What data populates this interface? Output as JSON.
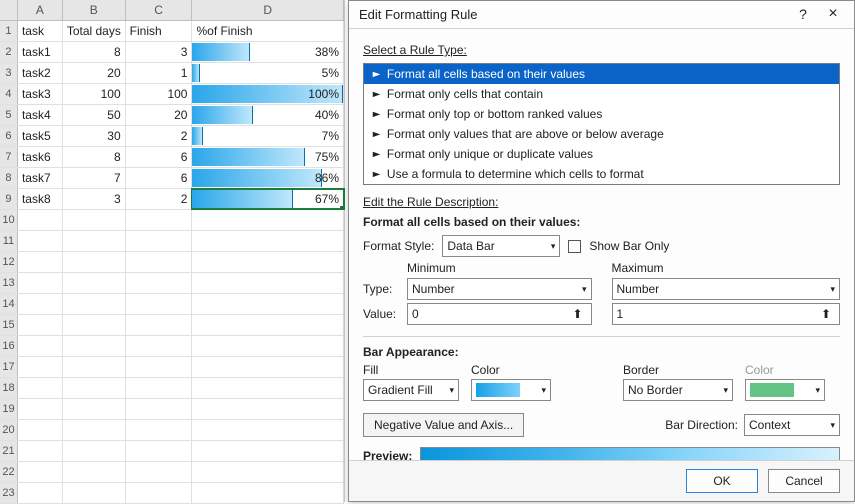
{
  "sheet": {
    "columns": [
      "A",
      "B",
      "C",
      "D"
    ],
    "header_row": [
      "task",
      "Total days",
      "Finish",
      "%of Finish"
    ],
    "rows": [
      {
        "task": "task1",
        "total": 8,
        "finish": 3,
        "pct": "38%",
        "bar": 0.38
      },
      {
        "task": "task2",
        "total": 20,
        "finish": 1,
        "pct": "5%",
        "bar": 0.05
      },
      {
        "task": "task3",
        "total": 100,
        "finish": 100,
        "pct": "100%",
        "bar": 1.0
      },
      {
        "task": "task4",
        "total": 50,
        "finish": 20,
        "pct": "40%",
        "bar": 0.4
      },
      {
        "task": "task5",
        "total": 30,
        "finish": 2,
        "pct": "7%",
        "bar": 0.07
      },
      {
        "task": "task6",
        "total": 8,
        "finish": 6,
        "pct": "75%",
        "bar": 0.75
      },
      {
        "task": "task7",
        "total": 7,
        "finish": 6,
        "pct": "86%",
        "bar": 0.86
      },
      {
        "task": "task8",
        "total": 3,
        "finish": 2,
        "pct": "67%",
        "bar": 0.67
      }
    ],
    "extra_row_count": 14,
    "selected_cell": "D9"
  },
  "dialog": {
    "title": "Edit Formatting Rule",
    "select_rule_label": "Select a Rule Type:",
    "rule_types": [
      "Format all cells based on their values",
      "Format only cells that contain",
      "Format only top or bottom ranked values",
      "Format only values that are above or below average",
      "Format only unique or duplicate values",
      "Use a formula to determine which cells to format"
    ],
    "selected_rule_index": 0,
    "edit_desc_label": "Edit the Rule Description:",
    "subheader": "Format all cells based on their values:",
    "format_style_label": "Format Style:",
    "format_style_value": "Data Bar",
    "show_bar_only_label": "Show Bar Only",
    "min_label": "Minimum",
    "max_label": "Maximum",
    "type_label": "Type:",
    "type_min": "Number",
    "type_max": "Number",
    "value_label": "Value:",
    "value_min": "0",
    "value_max": "1",
    "bar_appearance_label": "Bar Appearance:",
    "fill_label": "Fill",
    "fill_value": "Gradient Fill",
    "color_label": "Color",
    "border_label": "Border",
    "border_value": "No Border",
    "border_color_label": "Color",
    "neg_axis_label": "Negative Value and Axis...",
    "bar_dir_label": "Bar Direction:",
    "bar_dir_value": "Context",
    "preview_label": "Preview:",
    "ok_label": "OK",
    "cancel_label": "Cancel"
  }
}
